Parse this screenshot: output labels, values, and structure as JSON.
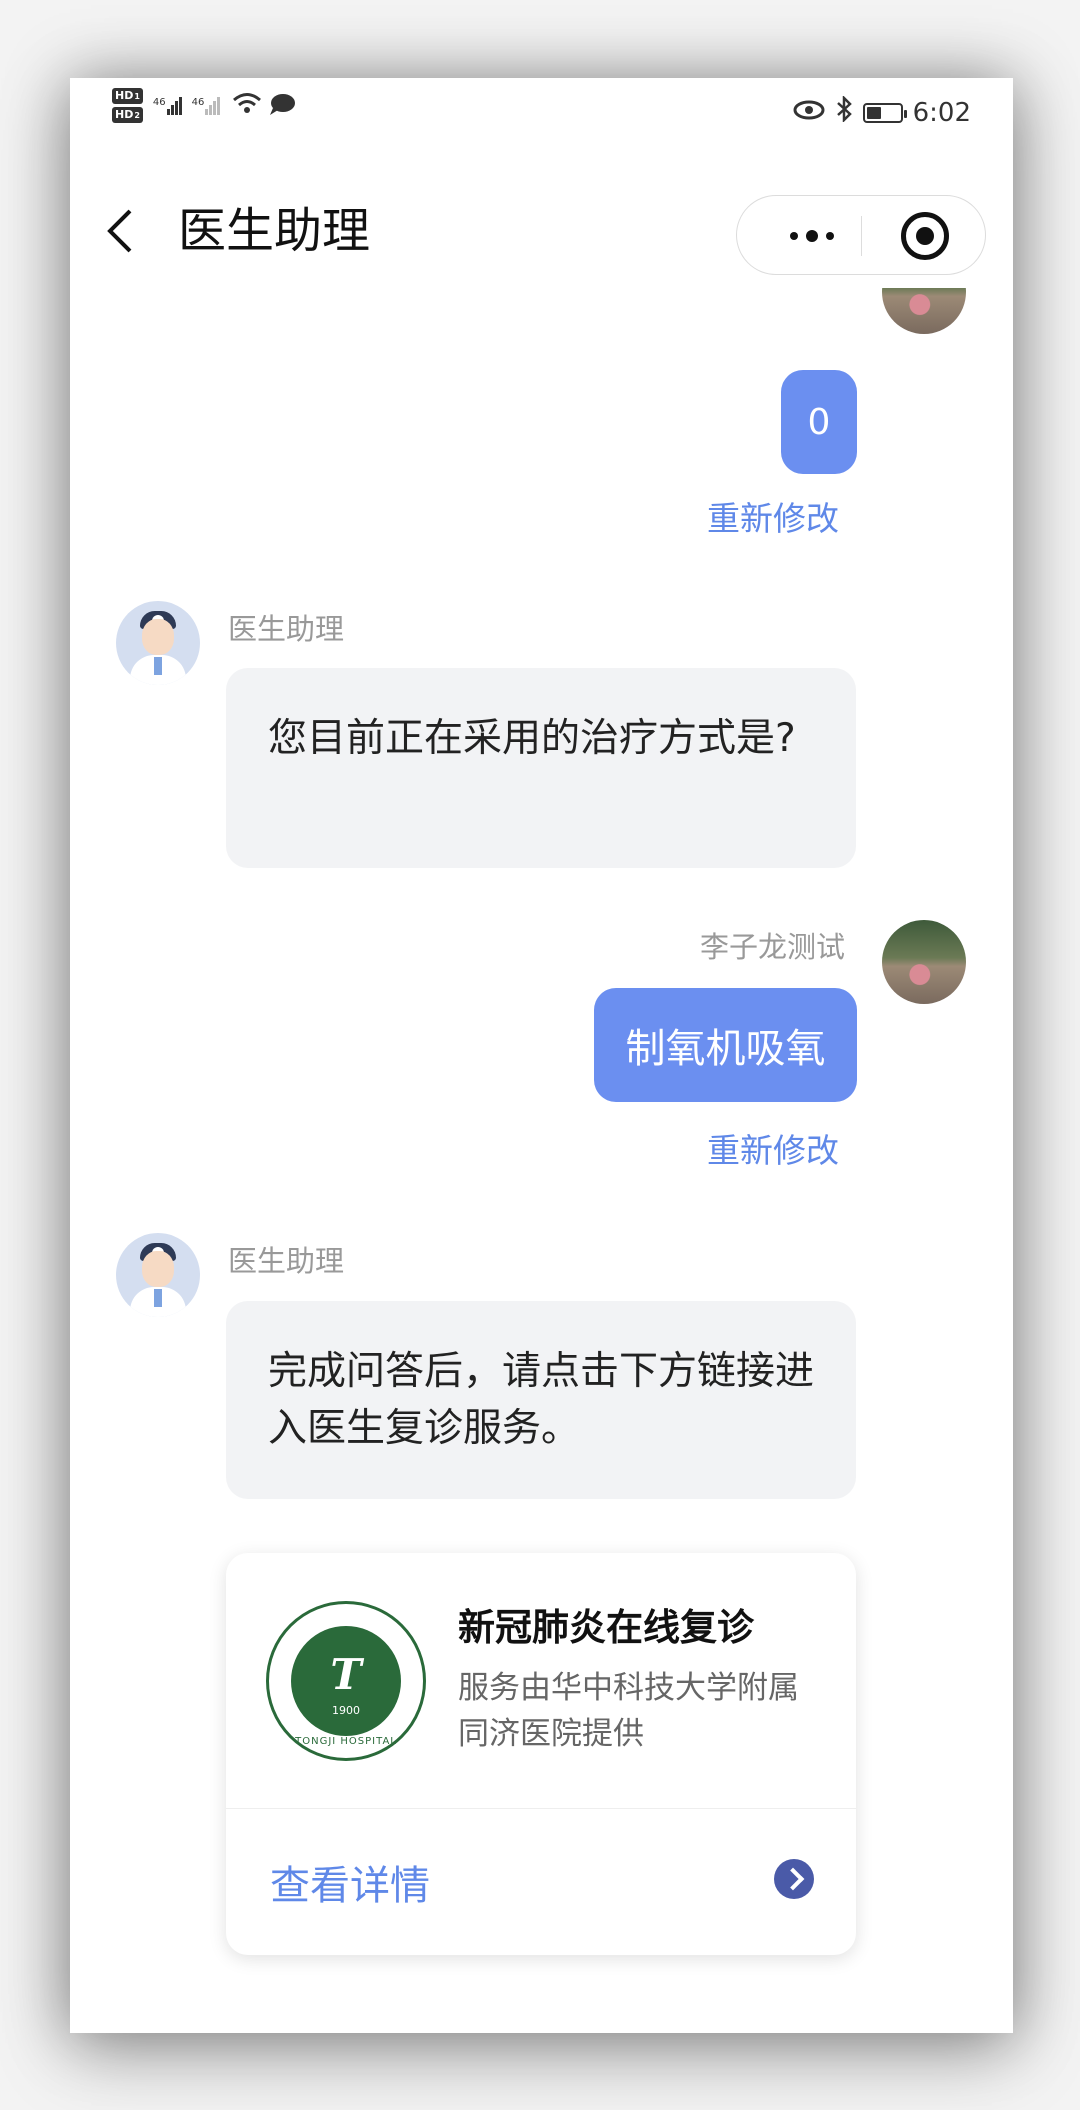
{
  "status_bar": {
    "hd1": "HD",
    "hd1_sub": "1",
    "hd2": "HD",
    "hd2_sub": "2",
    "net1": "46",
    "net2": "46",
    "time": "6:02"
  },
  "nav": {
    "title": "医生助理"
  },
  "messages": {
    "user_answer_1": "0",
    "edit_1": "重新修改",
    "doctor_name_1": "医生助理",
    "doctor_q1": "您目前正在采用的治疗方式是?",
    "user_name": "李子龙测试",
    "user_answer_2": "制氧机吸氧",
    "edit_2": "重新修改",
    "doctor_name_2": "医生助理",
    "doctor_q2": "完成问答后，请点击下方链接进入医生复诊服务。"
  },
  "card": {
    "title": "新冠肺炎在线复诊",
    "description": "服务由华中科技大学附属同济医院提供",
    "link_label": "查看详情",
    "logo_year": "1900",
    "logo_text": "TONGJI HOSPITAL"
  },
  "colors": {
    "accent": "#6b8ff0",
    "link": "#5f88e8",
    "bubble_bg": "#f2f3f5"
  },
  "icons": {
    "back": "chevron-left-icon",
    "more": "more-dots-icon",
    "close": "target-icon",
    "card_arrow": "chevron-right-circle-icon"
  }
}
